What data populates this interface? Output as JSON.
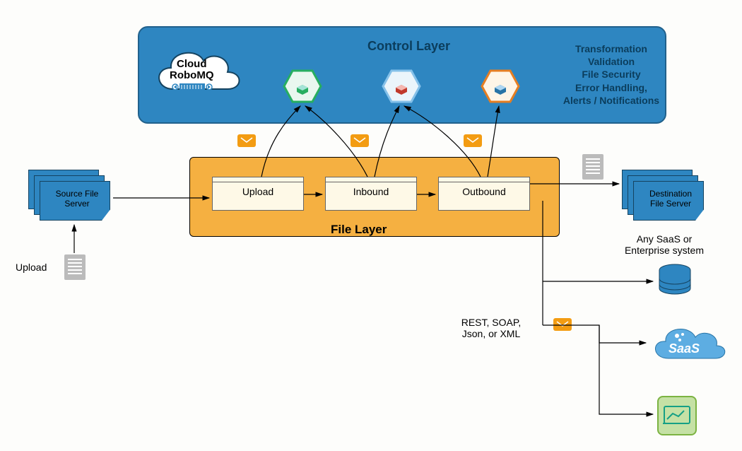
{
  "control_layer": {
    "title": "Control Layer",
    "cloud_line1": "Cloud",
    "cloud_line2": "RoboMQ",
    "features": "Transformation\nValidation\nFile Security\nError Handling,\nAlerts / Notifications"
  },
  "file_layer": {
    "title": "File Layer",
    "stage1": "Upload",
    "stage2": "Inbound",
    "stage3": "Outbound"
  },
  "source": {
    "label": "Source File\nServer",
    "upload_label": "Upload"
  },
  "destination": {
    "label": "Destination\nFile Server",
    "note": "Any SaaS or\nEnterprise system"
  },
  "protocols_label": "REST, SOAP,\nJson, or XML",
  "saas_label": "SaaS"
}
